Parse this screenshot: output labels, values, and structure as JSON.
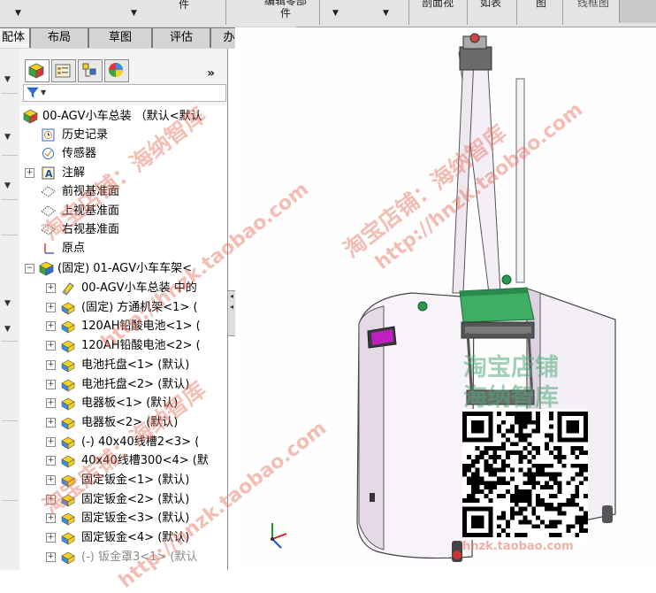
{
  "toolbar": {
    "items": [
      {
        "label": "件"
      },
      {
        "label": "编辑零部件"
      },
      {
        "label": "剖面视"
      },
      {
        "label": "如表"
      },
      {
        "label": "图"
      },
      {
        "label": "线框图"
      }
    ]
  },
  "tabs": [
    {
      "label": "配体",
      "active": true
    },
    {
      "label": "布局",
      "active": false
    },
    {
      "label": "草图",
      "active": false
    },
    {
      "label": "评估",
      "active": false
    },
    {
      "label": "办公室产品",
      "active": false
    }
  ],
  "panel": {
    "tab_icons": [
      "feature-manager-icon",
      "property-manager-icon",
      "configuration-manager-icon",
      "appearance-icon"
    ],
    "collapse_symbol": "»",
    "filter_symbol": "▼"
  },
  "tree": {
    "root": "00-AGV小车总装 （默认<默认",
    "top_items": [
      {
        "label": "历史记录",
        "icon": "history-icon"
      },
      {
        "label": "传感器",
        "icon": "sensor-icon"
      },
      {
        "label": "注解",
        "icon": "annotation-icon"
      },
      {
        "label": "前视基准面",
        "icon": "plane-icon"
      },
      {
        "label": "上视基准面",
        "icon": "plane-icon"
      },
      {
        "label": "右视基准面",
        "icon": "plane-icon"
      },
      {
        "label": "原点",
        "icon": "origin-icon"
      }
    ],
    "subassembly": "(固定) 01-AGV小车车架<",
    "children": [
      {
        "label": "00-AGV小车总装 中的",
        "icon": "mate-icon"
      },
      {
        "label": "(固定) 方通机架<1> (",
        "icon": "part-icon"
      },
      {
        "label": "120AH铅酸电池<1> (",
        "icon": "part-icon"
      },
      {
        "label": "120AH铅酸电池<2> (",
        "icon": "part-icon"
      },
      {
        "label": "电池托盘<1> (默认)",
        "icon": "part-icon"
      },
      {
        "label": "电池托盘<2> (默认)",
        "icon": "part-icon"
      },
      {
        "label": "电器板<1> (默认)",
        "icon": "part-icon"
      },
      {
        "label": "电器板<2> (默认)",
        "icon": "part-icon"
      },
      {
        "label": "(-) 40x40线槽2<3> (",
        "icon": "part-icon"
      },
      {
        "label": "40x40线槽300<4> (默",
        "icon": "part-icon"
      },
      {
        "label": "固定钣金<1> (默认)",
        "icon": "part-icon"
      },
      {
        "label": "固定钣金<2> (默认)",
        "icon": "part-icon"
      },
      {
        "label": "固定钣金<3> (默认)",
        "icon": "part-icon"
      },
      {
        "label": "固定钣金<4> (默认)",
        "icon": "part-icon"
      },
      {
        "label": "(-) 钣金罩3<1> (默认",
        "icon": "part-icon",
        "dim": true
      }
    ]
  },
  "watermarks": {
    "shop": "淘宝店铺：海纳智库",
    "url": "http://hnzk.taobao.com",
    "viewport_line1": "淘宝店铺",
    "viewport_line2": "海纳智库",
    "qr_url": "hnzk.taobao.com"
  },
  "colors": {
    "body_white": "#f4eef6",
    "body_shadow": "#c9bccf",
    "top_panel": "#3fae62",
    "magenta_screen": "#c020c0",
    "frame_dark": "#555555"
  }
}
